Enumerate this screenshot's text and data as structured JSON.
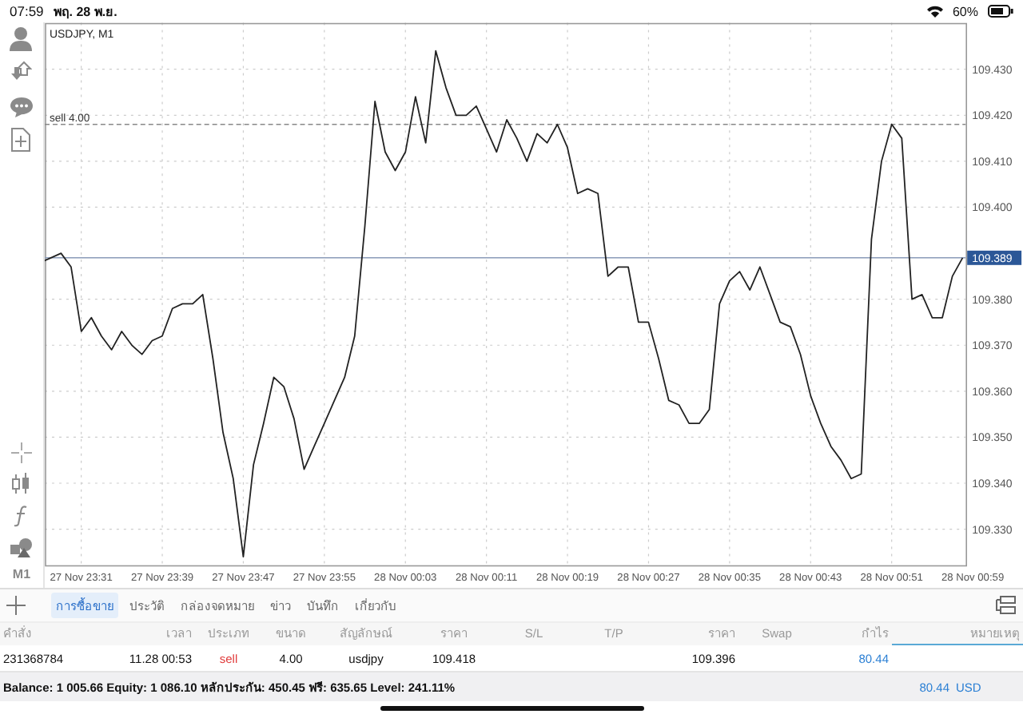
{
  "status_bar": {
    "time": "07:59",
    "date": "พฤ. 28 พ.ย.",
    "battery": "60%"
  },
  "left_toolbar": {
    "timeframe": "M1"
  },
  "chart": {
    "chart_data": {
      "type": "line",
      "title": "USDJPY, M1",
      "ylim": [
        109.3222,
        109.4401
      ],
      "categories": [
        null,
        null,
        null,
        null,
        "27 Nov 23:31",
        null,
        null,
        null,
        null,
        null,
        null,
        null,
        "27 Nov 23:39",
        null,
        null,
        null,
        null,
        null,
        null,
        null,
        "27 Nov 23:47",
        null,
        null,
        null,
        null,
        null,
        null,
        null,
        "27 Nov 23:55",
        null,
        null,
        null,
        null,
        null,
        null,
        null,
        "28 Nov 00:03",
        null,
        null,
        null,
        null,
        null,
        null,
        null,
        "28 Nov 00:11",
        null,
        null,
        null,
        null,
        null,
        null,
        null,
        "28 Nov 00:19",
        null,
        null,
        null,
        null,
        null,
        null,
        null,
        "28 Nov 00:27",
        null,
        null,
        null,
        null,
        null,
        null,
        null,
        "28 Nov 00:35",
        null,
        null,
        null,
        null,
        null,
        null,
        null,
        "28 Nov 00:43",
        null,
        null,
        null,
        null,
        null,
        null,
        null,
        "28 Nov 00:51",
        null,
        null,
        null,
        null,
        null,
        null,
        null,
        "28 Nov 00:59"
      ],
      "series": [
        {
          "color": "#222222",
          "values": [
            109.388,
            109.389,
            109.39,
            109.387,
            109.373,
            109.376,
            109.372,
            109.369,
            109.373,
            109.37,
            109.368,
            109.371,
            109.372,
            109.378,
            109.379,
            109.379,
            109.381,
            109.367,
            109.351,
            109.341,
            109.324,
            109.344,
            109.353,
            109.363,
            109.361,
            109.354,
            109.343,
            109.348,
            109.353,
            109.358,
            109.363,
            109.372,
            109.396,
            109.423,
            109.412,
            109.408,
            109.412,
            109.424,
            109.414,
            109.434,
            109.426,
            109.42,
            109.42,
            109.422,
            109.417,
            109.412,
            109.419,
            109.415,
            109.41,
            109.416,
            109.414,
            109.418,
            109.413,
            109.403,
            109.404,
            109.403,
            109.385,
            109.387,
            109.387,
            109.375,
            109.375,
            109.367,
            109.358,
            109.357,
            109.353,
            109.353,
            109.356,
            109.379,
            109.384,
            109.386,
            109.382,
            109.387,
            109.381,
            109.375,
            109.374,
            109.368,
            109.359,
            109.353,
            109.348,
            109.345,
            109.341,
            109.342,
            109.393,
            109.41,
            109.418,
            109.415,
            109.38,
            109.381,
            109.376,
            109.376,
            109.385,
            109.389,
            null
          ]
        }
      ],
      "yticks": [
        {
          "value": 109.33,
          "label": "109.330"
        },
        {
          "value": 109.34,
          "label": "109.340"
        },
        {
          "value": 109.35,
          "label": "109.350"
        },
        {
          "value": 109.36,
          "label": "109.360"
        },
        {
          "value": 109.37,
          "label": "109.370"
        },
        {
          "value": 109.38,
          "label": "109.380"
        },
        {
          "value": 109.4,
          "label": "109.400"
        },
        {
          "value": 109.41,
          "label": "109.410"
        },
        {
          "value": 109.42,
          "label": "109.420"
        },
        {
          "value": 109.43,
          "label": "109.430"
        }
      ],
      "grid": true,
      "ref_lines": [
        {
          "axis": "y",
          "value": 109.418,
          "label": "sell 4.00"
        },
        {
          "axis": "y",
          "value": 109.389,
          "label": "109.389"
        }
      ]
    }
  },
  "tabs": [
    {
      "label": "การซื้อขาย",
      "selected": true
    },
    {
      "label": "ประวัติ",
      "selected": false
    },
    {
      "label": "กล่องจดหมาย",
      "selected": false
    },
    {
      "label": "ข่าว",
      "selected": false
    },
    {
      "label": "บันทึก",
      "selected": false
    },
    {
      "label": "เกี่ยวกับ",
      "selected": false
    }
  ],
  "table": {
    "columns": [
      {
        "label": "คำสั่ง",
        "selected": false
      },
      {
        "label": "เวลา",
        "selected": false
      },
      {
        "label": "ประเภท",
        "selected": false
      },
      {
        "label": "ขนาด",
        "selected": false
      },
      {
        "label": "สัญลักษณ์",
        "selected": false
      },
      {
        "label": "ราคา",
        "selected": false
      },
      {
        "label": "S/L",
        "selected": false
      },
      {
        "label": "T/P",
        "selected": false
      },
      {
        "label": "ราคา",
        "selected": false
      },
      {
        "label": "Swap",
        "selected": false
      },
      {
        "label": "กำไร",
        "selected": false
      },
      {
        "label": "หมายเหตุ",
        "selected": true
      }
    ],
    "rows": [
      {
        "order": "231368784",
        "time": "11.28 00:53",
        "type": "sell",
        "volume": "4.00",
        "symbol": "usdjpy",
        "open_price": "109.418",
        "current_price": "109.396",
        "profit": "80.44"
      }
    ]
  },
  "summary": {
    "text": "Balance: 1 005.66 Equity: 1 086.10 หลักประกัน: 450.45 ฟรี: 635.65 Level: 241.11%",
    "profit": "80.44",
    "currency": "USD"
  }
}
